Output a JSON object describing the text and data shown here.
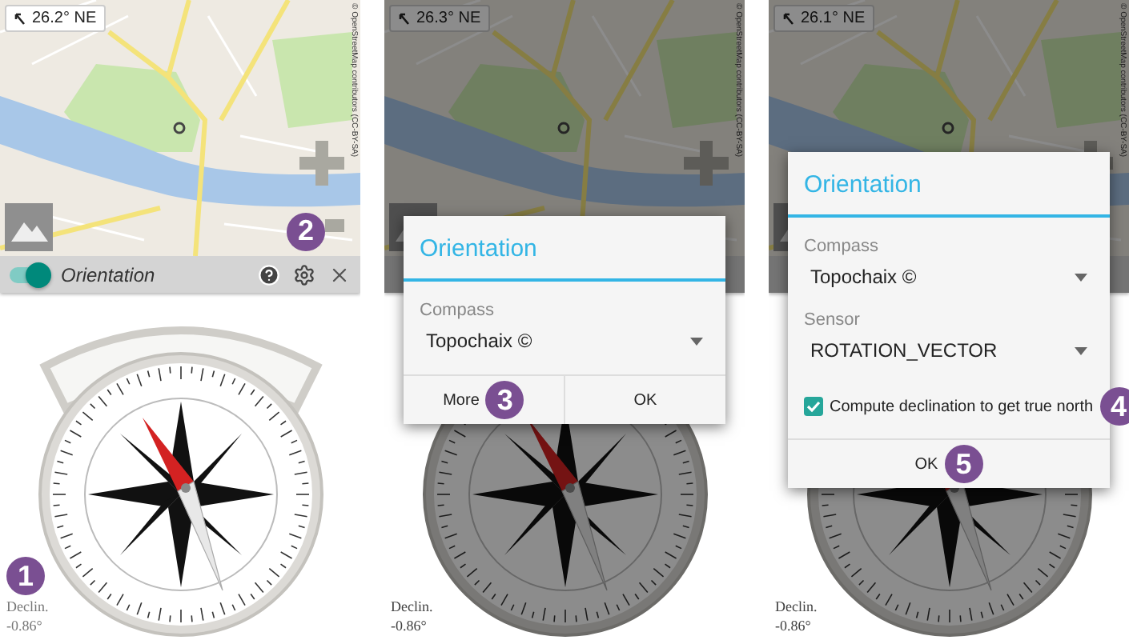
{
  "panels": [
    {
      "heading": "26.2° NE",
      "attribution": "© OpenStreetMap contributors (CC-BY-SA)",
      "toolbar": {
        "switch_on": true,
        "label": "Orientation",
        "settings_marker": "2"
      },
      "declination": {
        "label": "Declin.",
        "value": "-0.86°",
        "marker": "1"
      }
    },
    {
      "heading": "26.3° NE",
      "attribution": "© OpenStreetMap contributors (CC-BY-SA)",
      "declination": {
        "label": "Declin.",
        "value": "-0.86°"
      },
      "dialog": {
        "title": "Orientation",
        "fields": [
          {
            "label": "Compass",
            "value": "Topochaix ©"
          }
        ],
        "buttons": [
          {
            "label": "More",
            "marker": "3"
          },
          {
            "label": "OK"
          }
        ]
      }
    },
    {
      "heading": "26.1° NE",
      "attribution": "© OpenStreetMap contributors (CC-BY-SA)",
      "declination": {
        "label": "Declin.",
        "value": "-0.86°"
      },
      "dialog": {
        "title": "Orientation",
        "fields": [
          {
            "label": "Compass",
            "value": "Topochaix ©"
          },
          {
            "label": "Sensor",
            "value": "ROTATION_VECTOR"
          }
        ],
        "checkbox": {
          "label": "Compute declination to get true north",
          "checked": true,
          "marker": "4"
        },
        "buttons": [
          {
            "label": "OK",
            "marker": "5"
          }
        ]
      }
    }
  ]
}
